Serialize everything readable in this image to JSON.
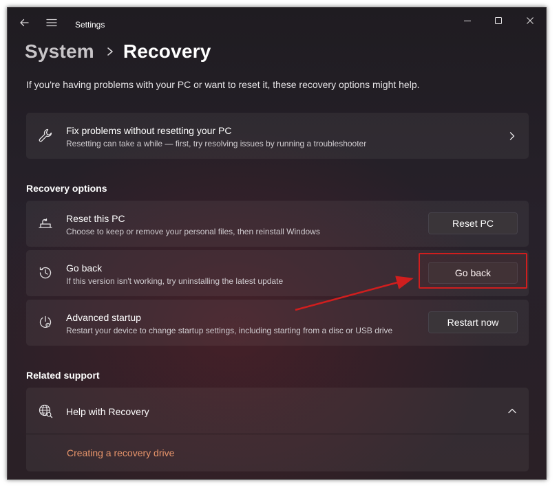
{
  "window": {
    "title": "Settings"
  },
  "breadcrumb": {
    "parent": "System",
    "current": "Recovery"
  },
  "description": "If you're having problems with your PC or want to reset it, these recovery options might help.",
  "fix_card": {
    "title": "Fix problems without resetting your PC",
    "subtitle": "Resetting can take a while — first, try resolving issues by running a troubleshooter",
    "icon": "wrench-icon"
  },
  "recovery_options": {
    "label": "Recovery options",
    "items": [
      {
        "title": "Reset this PC",
        "subtitle": "Choose to keep or remove your personal files, then reinstall Windows",
        "button": "Reset PC",
        "icon": "reset-pc-icon"
      },
      {
        "title": "Go back",
        "subtitle": "If this version isn't working, try uninstalling the latest update",
        "button": "Go back",
        "icon": "history-icon"
      },
      {
        "title": "Advanced startup",
        "subtitle": "Restart your device to change startup settings, including starting from a disc or USB drive",
        "button": "Restart now",
        "icon": "advanced-startup-icon"
      }
    ]
  },
  "related_support": {
    "label": "Related support",
    "help_title": "Help with Recovery",
    "help_icon": "globe-icon",
    "link": "Creating a recovery drive"
  },
  "colors": {
    "accent_link": "#e8956b",
    "highlight": "#d01e1e"
  }
}
